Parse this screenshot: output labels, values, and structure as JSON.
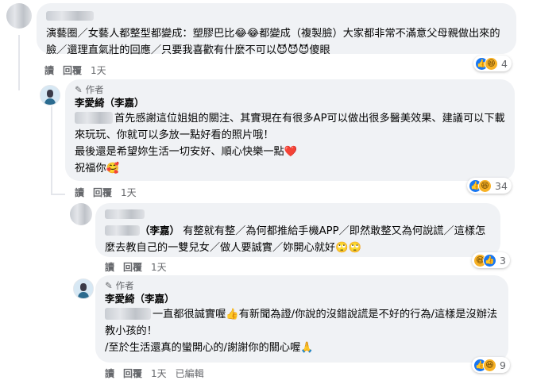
{
  "comments": [
    {
      "text": "演藝圈／女藝人都整型都變成：塑膠巴比😂😂都變成（複製臉）大家都非常不滿意父母親做出來的臉／還理直氣壯的回應／只要我喜歡有什麼不可以😈😈😈傻眼",
      "actions": {
        "reply_read": "讀",
        "reply": "回覆",
        "time": "1天"
      },
      "reactions": {
        "count": "4",
        "icons": [
          "like",
          "haha"
        ]
      }
    },
    {
      "author_badge": "作者",
      "name": "李愛綺（李嘉）",
      "lines": [
        "首先感謝這位姐姐的關注、其實現在有很多AP可以做出很多醫美效果、建議可以下載來玩玩、你就可以多放一點好看的照片哦！",
        "最後還是希望妳生活一切安好、順心快樂一點❤️",
        "祝福你🥰"
      ],
      "actions": {
        "reply_read": "讀",
        "reply": "回覆",
        "time": "1天"
      },
      "reactions": {
        "count": "34",
        "icons": [
          "like",
          "haha"
        ]
      }
    },
    {
      "name": "（李嘉）",
      "text": "有整就有整／為何都推給手機APP／即然敢整又為何說謊／這樣怎麼去教自己的一雙兒女／做人要誠實／妳開心就好🙄🙄",
      "actions": {
        "reply_read": "讀",
        "reply": "回覆",
        "time": "1天"
      },
      "reactions": {
        "count": "3",
        "icons": [
          "haha",
          "like"
        ]
      }
    },
    {
      "author_badge": "作者",
      "name": "李愛綺（李嘉）",
      "lines": [
        "一直都很誠實喔👍有新聞為證/你說的沒錯說謊是不好的行為/這樣是沒辦法教小孩的！",
        "/至於生活還真的蠻開心的/謝謝你的關心喔🙏"
      ],
      "actions": {
        "reply_read": "讀",
        "reply": "回覆",
        "time": "1天",
        "edited": "已編輯"
      },
      "reactions": {
        "count": "9",
        "icons": [
          "like",
          "haha"
        ]
      }
    }
  ],
  "icons": {
    "author": "pencil-icon",
    "like": "thumbs-up-icon",
    "haha": "laughing-face-icon"
  },
  "colors": {
    "bubble": "#f0f2f5",
    "like": "#1877f2",
    "haha": "#f7b125",
    "meta": "#65676b"
  }
}
